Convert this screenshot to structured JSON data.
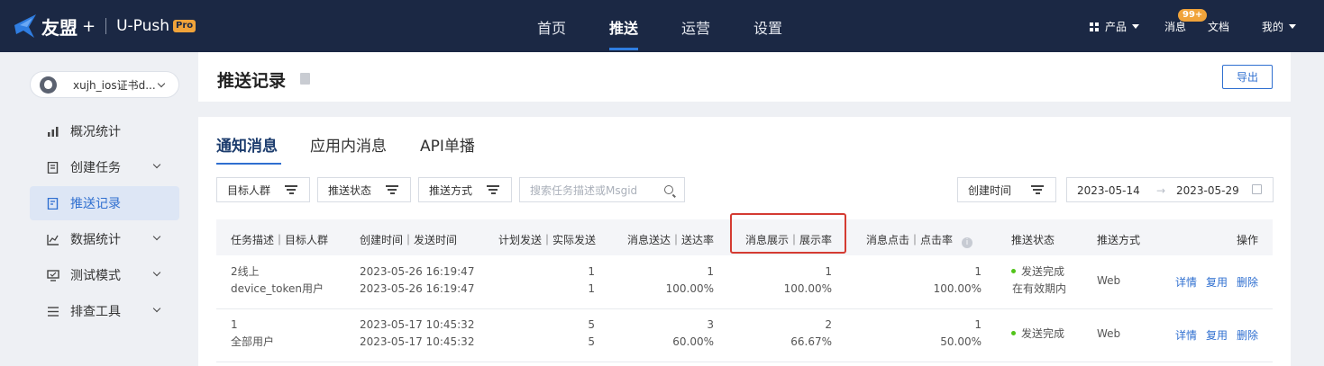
{
  "topbar": {
    "brand": "友盟",
    "brand_plus": "+",
    "product": "U-Push",
    "product_badge": "Pro",
    "nav": [
      "首页",
      "推送",
      "运营",
      "设置"
    ],
    "active_nav": "推送",
    "products_label": "产品",
    "messages_label": "消息",
    "messages_badge": "99+",
    "docs_label": "文档",
    "mine_label": "我的"
  },
  "sidebar": {
    "app_name": "xujh_ios证书d...",
    "items": [
      {
        "label": "概况统计",
        "icon": "chart-icon"
      },
      {
        "label": "创建任务",
        "icon": "task-icon"
      },
      {
        "label": "推送记录",
        "icon": "record-icon"
      },
      {
        "label": "数据统计",
        "icon": "line-chart-icon"
      },
      {
        "label": "测试模式",
        "icon": "monitor-icon"
      },
      {
        "label": "排查工具",
        "icon": "list-icon"
      }
    ],
    "active_item": "推送记录"
  },
  "header": {
    "title": "推送记录",
    "export_label": "导出"
  },
  "tabs": [
    "通知消息",
    "应用内消息",
    "API单播"
  ],
  "active_tab": "通知消息",
  "filters": {
    "target": "目标人群",
    "status": "推送状态",
    "method": "推送方式",
    "search_placeholder": "搜索任务描述或Msgid",
    "created_time": "创建时间",
    "date_from": "2023-05-14",
    "date_arrow": "→",
    "date_to": "2023-05-29"
  },
  "table": {
    "headers": {
      "desc": "任务描述｜目标人群",
      "time": "创建时间｜发送时间",
      "plan": "计划发送｜实际发送",
      "delivered": "消息送达｜送达率",
      "shown": "消息展示｜展示率",
      "clicked": "消息点击｜点击率",
      "status": "推送状态",
      "method": "推送方式",
      "ops": "操作"
    },
    "rows": [
      {
        "desc": "2线上",
        "audience": "device_token用户",
        "created": "2023-05-26 16:19:47",
        "sent": "2023-05-26 16:19:47",
        "plan": "1",
        "actual": "1",
        "delivered": "1",
        "delivered_rate": "100.00%",
        "shown": "1",
        "shown_rate": "100.00%",
        "clicked": "1",
        "clicked_rate": "100.00%",
        "status": "发送完成",
        "status_sub": "在有效期内",
        "method": "Web",
        "ops": [
          "详情",
          "复用",
          "删除"
        ]
      },
      {
        "desc": "1",
        "audience": "全部用户",
        "created": "2023-05-17 10:45:32",
        "sent": "2023-05-17 10:45:32",
        "plan": "5",
        "actual": "5",
        "delivered": "3",
        "delivered_rate": "60.00%",
        "shown": "2",
        "shown_rate": "66.67%",
        "clicked": "1",
        "clicked_rate": "50.00%",
        "status": "发送完成",
        "status_sub": "",
        "method": "Web",
        "ops": [
          "详情",
          "复用",
          "删除"
        ]
      }
    ]
  },
  "colors": {
    "topbar": "#1b2844",
    "accent": "#2f6fd0",
    "badge": "#f0a33a",
    "highlight": "#d43b32",
    "success": "#52c41a"
  }
}
